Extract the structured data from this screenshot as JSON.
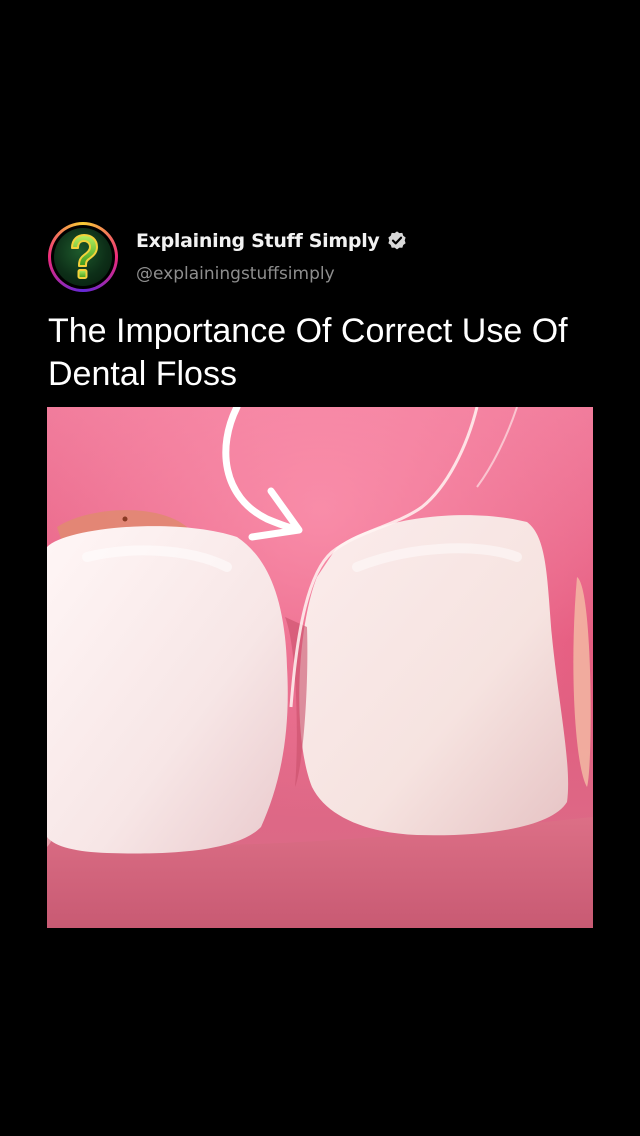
{
  "post": {
    "author": {
      "display_name": "Explaining Stuff Simply",
      "handle": "@explainingstuffsimply",
      "verified": true,
      "avatar_icon": "question-mark-icon"
    },
    "title": "The Importance Of Correct Use Of Dental Floss",
    "media": {
      "icon": "dental-floss-teeth-image",
      "overlay": "curved-arrow-icon"
    }
  },
  "colors": {
    "background": "#000000",
    "handle_text": "#8e8e8e",
    "avatar_ring": "#ee2a7b",
    "avatar_bg": "#0d2f18",
    "question_mark": "#6fcf3a",
    "verified_badge": "#d8d8d8"
  }
}
